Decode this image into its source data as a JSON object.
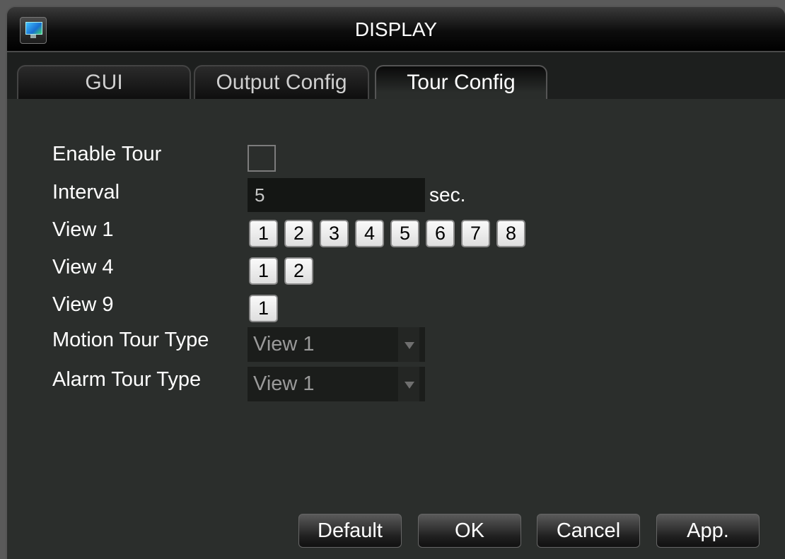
{
  "window": {
    "title": "DISPLAY",
    "icon": "monitor-icon"
  },
  "tabs": [
    {
      "label": "GUI",
      "active": false
    },
    {
      "label": "Output Config",
      "active": false
    },
    {
      "label": "Tour Config",
      "active": true
    }
  ],
  "form": {
    "enable_tour": {
      "label": "Enable Tour",
      "checked": false
    },
    "interval": {
      "label": "Interval",
      "value": "5",
      "unit": "sec."
    },
    "view1": {
      "label": "View 1",
      "items": [
        "1",
        "2",
        "3",
        "4",
        "5",
        "6",
        "7",
        "8"
      ]
    },
    "view4": {
      "label": "View 4",
      "items": [
        "1",
        "2"
      ]
    },
    "view9": {
      "label": "View 9",
      "items": [
        "1"
      ]
    },
    "motion_tour_type": {
      "label": "Motion Tour Type",
      "value": "View 1"
    },
    "alarm_tour_type": {
      "label": "Alarm Tour Type",
      "value": "View 1"
    }
  },
  "buttons": {
    "default": "Default",
    "ok": "OK",
    "cancel": "Cancel",
    "apply": "App."
  }
}
